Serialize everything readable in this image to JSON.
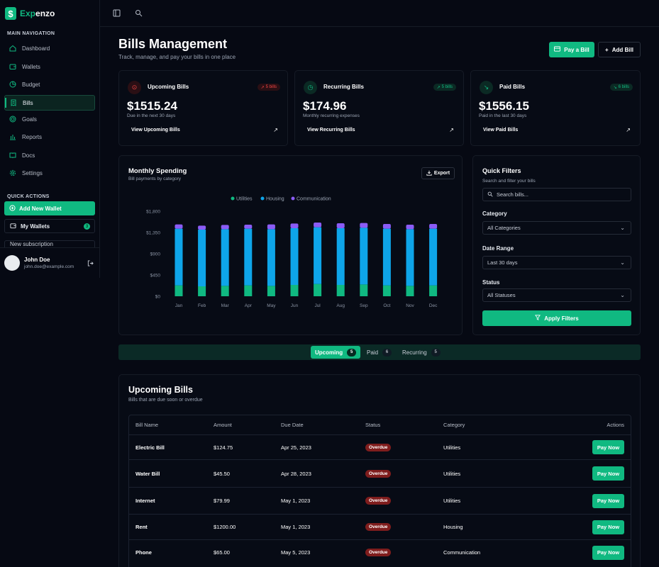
{
  "app": {
    "logo_glyph": "$",
    "logo_prefix": "Exp",
    "logo_suffix": "enzo",
    "accent": "#10b981"
  },
  "sidebar": {
    "main_title": "MAIN NAVIGATION",
    "items": [
      {
        "label": "Dashboard",
        "icon": "home-icon"
      },
      {
        "label": "Wallets",
        "icon": "wallet-icon"
      },
      {
        "label": "Budget",
        "icon": "pie-icon"
      },
      {
        "label": "Bills",
        "icon": "receipt-icon",
        "active": true
      },
      {
        "label": "Goals",
        "icon": "target-icon"
      },
      {
        "label": "Reports",
        "icon": "bar-chart-icon"
      },
      {
        "label": "Docs",
        "icon": "book-icon"
      },
      {
        "label": "Settings",
        "icon": "gear-icon"
      }
    ],
    "quick_title": "QUICK ACTIONS",
    "add_wallet": "Add New Wallet",
    "my_wallets": "My Wallets",
    "my_wallets_count": "3",
    "partial_item": "New subscription"
  },
  "user": {
    "name": "John Doe",
    "email": "john.doe@example.com"
  },
  "header": {
    "title": "Bills Management",
    "subtitle": "Track, manage, and pay your bills in one place",
    "pay_label": "Pay a Bill",
    "add_label": "Add Bill"
  },
  "cards": [
    {
      "title": "Upcoming Bills",
      "badge": "5 bills",
      "badge_arrow": "↗",
      "amount": "$1515.24",
      "desc": "Due in the next 30 days",
      "link": "View Upcoming Bills",
      "color": "#ef4444",
      "icon_bg": "#2a0f14",
      "badge_bg": "#2a0f14"
    },
    {
      "title": "Recurring Bills",
      "badge": "5 bills",
      "badge_arrow": "↗",
      "amount": "$174.96",
      "desc": "Monthly recurring expenses",
      "link": "View Recurring Bills",
      "color": "#10b981",
      "icon_bg": "#0b2a24",
      "badge_bg": "#0b2a24"
    },
    {
      "title": "Paid Bills",
      "badge": "6 bills",
      "badge_arrow": "↘",
      "amount": "$1556.15",
      "desc": "Paid in the last 30 days",
      "link": "View Paid Bills",
      "color": "#10b981",
      "icon_bg": "#0b2a24",
      "badge_bg": "#0b2a24"
    }
  ],
  "chart_panel": {
    "title": "Monthly Spending",
    "subtitle": "Bill payments by category",
    "export_label": "Export"
  },
  "chart_data": {
    "type": "bar",
    "stacked": true,
    "categories": [
      "Jan",
      "Feb",
      "Mar",
      "Apr",
      "May",
      "Jun",
      "Jul",
      "Aug",
      "Sep",
      "Oct",
      "Nov",
      "Dec"
    ],
    "series": [
      {
        "name": "Utilities",
        "color": "#10b981",
        "values": [
          230,
          210,
          220,
          230,
          220,
          240,
          260,
          240,
          250,
          230,
          220,
          230
        ]
      },
      {
        "name": "Housing",
        "color": "#0ea5e9",
        "values": [
          1200,
          1200,
          1200,
          1200,
          1200,
          1200,
          1200,
          1200,
          1200,
          1200,
          1200,
          1200
        ]
      },
      {
        "name": "Communication",
        "color": "#8b5cf6",
        "values": [
          90,
          85,
          90,
          85,
          100,
          100,
          100,
          105,
          100,
          100,
          95,
          100
        ]
      }
    ],
    "yticks": [
      "$0",
      "$450",
      "$900",
      "$1,350",
      "$1,800"
    ],
    "ylim": [
      0,
      1800
    ],
    "grid": false,
    "legend": "top"
  },
  "filters": {
    "title": "Quick Filters",
    "subtitle": "Search and filter your bills",
    "search_placeholder": "Search bills...",
    "category_label": "Category",
    "category_value": "All Categories",
    "date_label": "Date Range",
    "date_value": "Last 30 days",
    "status_label": "Status",
    "status_value": "All Statuses",
    "apply_label": "Apply Filters"
  },
  "tabs": [
    {
      "label": "Upcoming",
      "count": "5",
      "active": true
    },
    {
      "label": "Paid",
      "count": "6"
    },
    {
      "label": "Recurring",
      "count": "5"
    }
  ],
  "table": {
    "title": "Upcoming Bills",
    "subtitle": "Bills that are due soon or overdue",
    "headers": [
      "Bill Name",
      "Amount",
      "Due Date",
      "Status",
      "Category",
      "Actions"
    ],
    "pay_label": "Pay Now",
    "rows": [
      {
        "name": "Electric Bill",
        "amount": "$124.75",
        "due": "Apr 25, 2023",
        "status": "Overdue",
        "category": "Utilities"
      },
      {
        "name": "Water Bill",
        "amount": "$45.50",
        "due": "Apr 28, 2023",
        "status": "Overdue",
        "category": "Utilities"
      },
      {
        "name": "Internet",
        "amount": "$79.99",
        "due": "May 1, 2023",
        "status": "Overdue",
        "category": "Utilities"
      },
      {
        "name": "Rent",
        "amount": "$1200.00",
        "due": "May 1, 2023",
        "status": "Overdue",
        "category": "Housing"
      },
      {
        "name": "Phone",
        "amount": "$65.00",
        "due": "May 5, 2023",
        "status": "Overdue",
        "category": "Communication"
      }
    ]
  }
}
